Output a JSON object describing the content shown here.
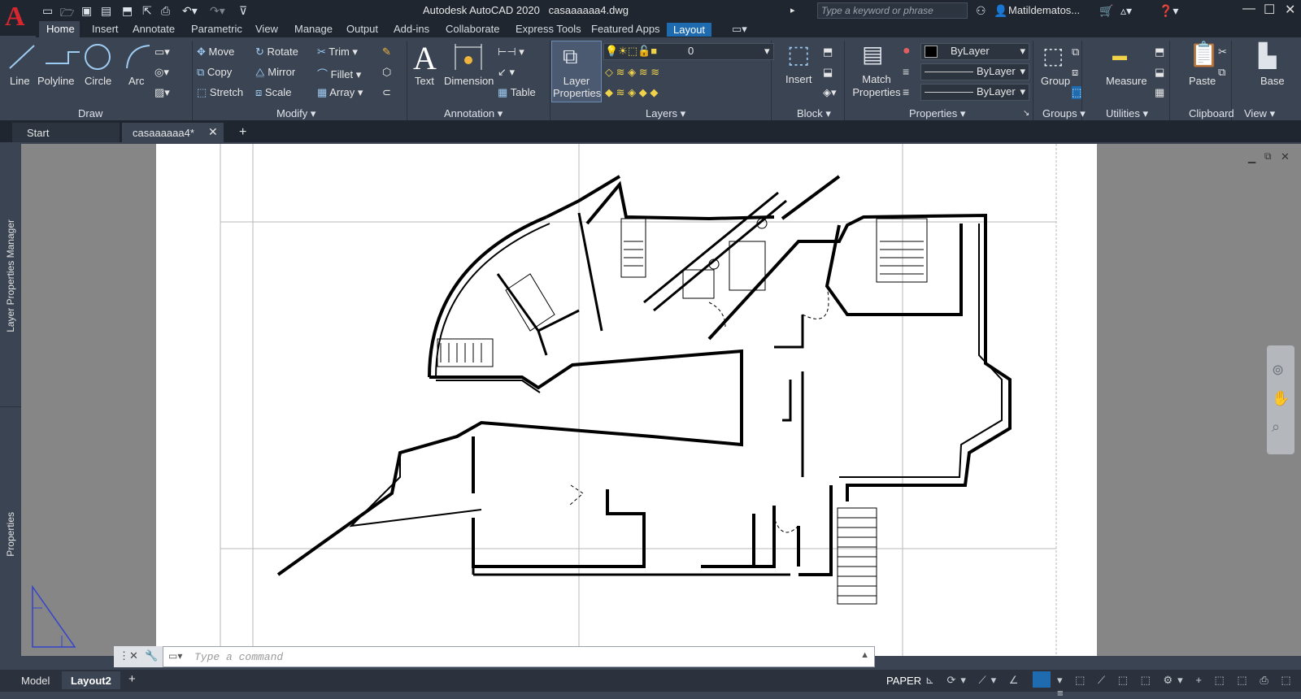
{
  "title": {
    "app": "Autodesk AutoCAD 2020",
    "file": "casaaaaaa4.dwg"
  },
  "search": {
    "placeholder": "Type a keyword or phrase"
  },
  "user": {
    "name": "Matildematos..."
  },
  "ribbon_tabs": [
    "Home",
    "Insert",
    "Annotate",
    "Parametric",
    "View",
    "Manage",
    "Output",
    "Add-ins",
    "Collaborate",
    "Express Tools",
    "Featured Apps",
    "Layout"
  ],
  "draw": {
    "title": "Draw",
    "line": "Line",
    "polyline": "Polyline",
    "circle": "Circle",
    "arc": "Arc"
  },
  "modify": {
    "title": "Modify",
    "move": "Move",
    "rotate": "Rotate",
    "trim": "Trim",
    "copy": "Copy",
    "mirror": "Mirror",
    "fillet": "Fillet",
    "stretch": "Stretch",
    "scale": "Scale",
    "array": "Array"
  },
  "annotation": {
    "title": "Annotation",
    "text": "Text",
    "dimension": "Dimension",
    "table": "Table"
  },
  "layers": {
    "title": "Layers",
    "layer_properties": "Layer Properties",
    "current_layer": "0"
  },
  "block": {
    "title": "Block",
    "insert": "Insert"
  },
  "properties": {
    "title": "Properties",
    "match": "Match Properties",
    "color": "ByLayer",
    "linetype": "ByLayer",
    "lineweight": "ByLayer"
  },
  "groups": {
    "title": "Groups",
    "group": "Group"
  },
  "utilities": {
    "title": "Utilities",
    "measure": "Measure"
  },
  "clipboard": {
    "title": "Clipboard",
    "paste": "Paste"
  },
  "view": {
    "title": "View",
    "base": "Base"
  },
  "doc_tabs": {
    "start": "Start",
    "current": "casaaaaaa4*"
  },
  "side": {
    "layer_manager": "Layer Properties Manager",
    "properties": "Properties"
  },
  "command": {
    "placeholder": "Type a command"
  },
  "layout_tabs": {
    "model": "Model",
    "layout2": "Layout2"
  },
  "status": {
    "space": "PAPER"
  },
  "colors": {
    "accent": "#1e6bb0",
    "logo": "#d6272e",
    "ribbon_bg": "#3b4453",
    "title_bg": "#1f2630"
  }
}
